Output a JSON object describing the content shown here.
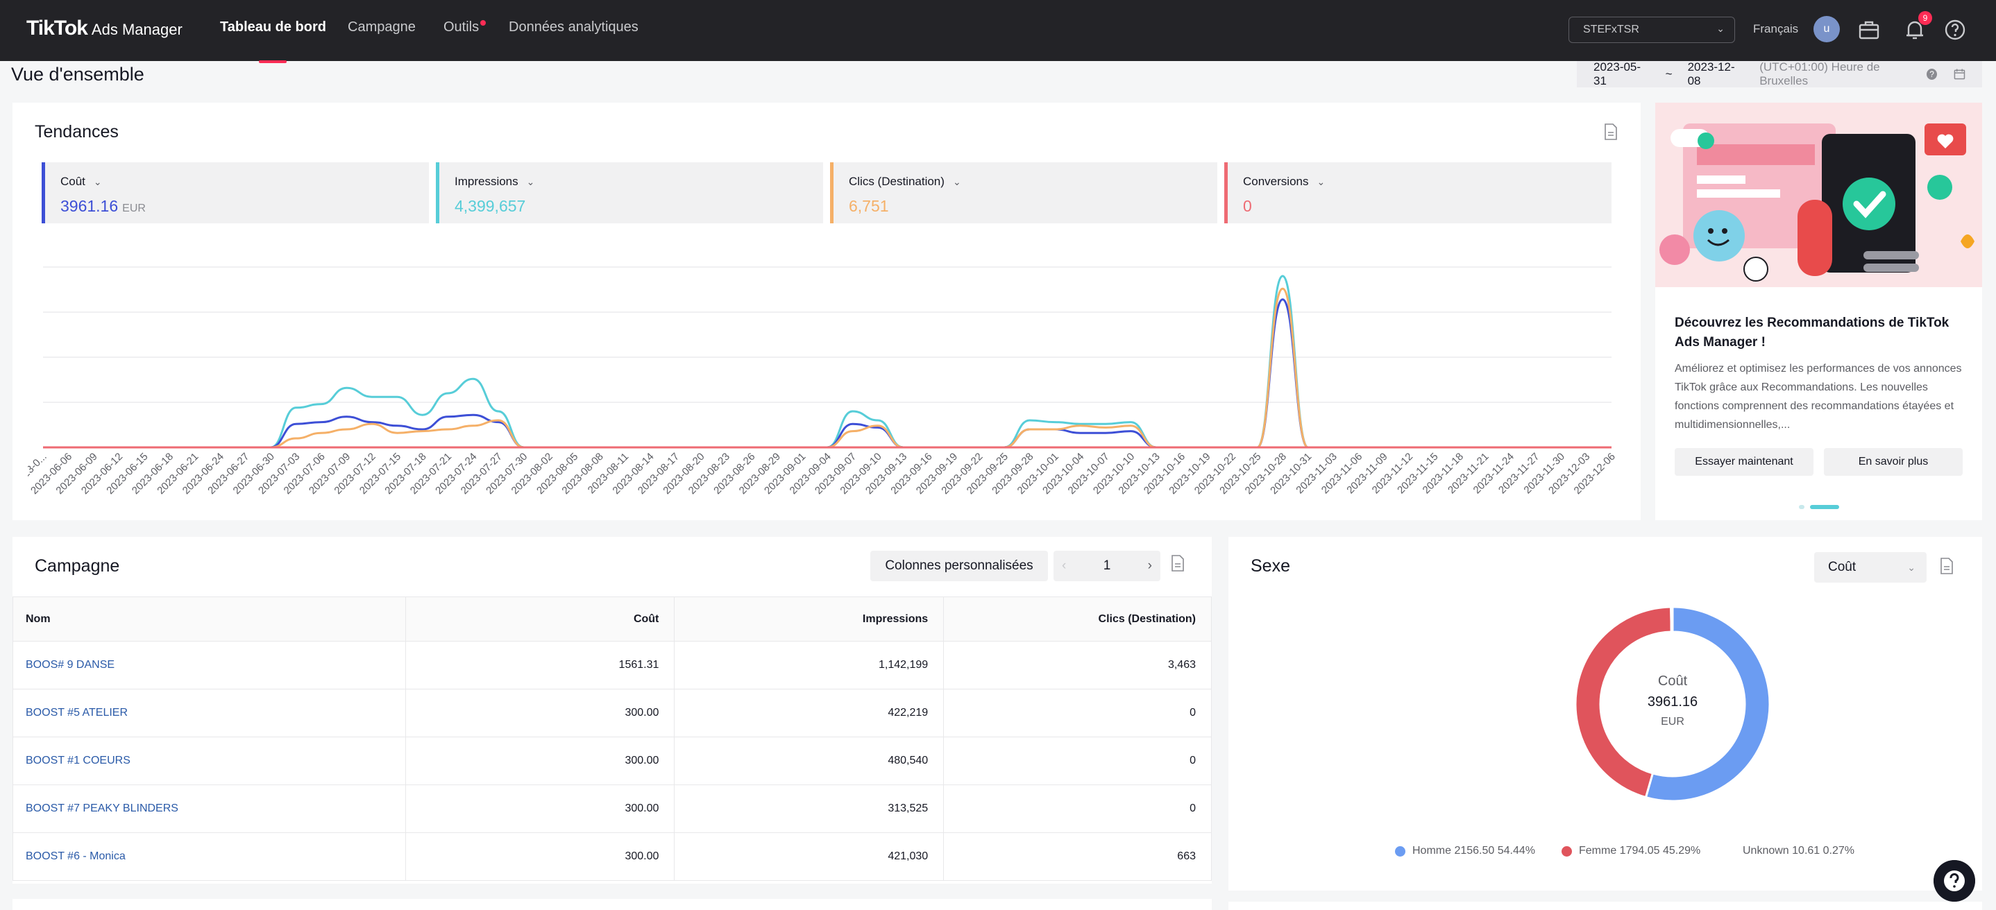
{
  "nav": {
    "brand": "TikTok",
    "product": "Ads Manager",
    "tabs": [
      {
        "label": "Tableau de bord",
        "active": true
      },
      {
        "label": "Campagne"
      },
      {
        "label": "Outils",
        "dot": true
      },
      {
        "label": "Données analytiques"
      }
    ],
    "account": "STEFxTSR",
    "language": "Français",
    "avatar_initial": "u",
    "notification_count": "9",
    "icons": [
      "briefcase-icon",
      "bell-icon",
      "help-icon"
    ]
  },
  "header": {
    "title": "Vue d'ensemble",
    "date_start": "2023-05-31",
    "date_sep": "~",
    "date_end": "2023-12-08",
    "timezone": "(UTC+01:00) Heure de Bruxelles"
  },
  "trends": {
    "title": "Tendances",
    "metrics": [
      {
        "label": "Coût",
        "value": "3961.16",
        "unit": "EUR",
        "color": "#3d4fd6"
      },
      {
        "label": "Impressions",
        "value": "4,399,657",
        "color": "#57cdd8"
      },
      {
        "label": "Clics (Destination)",
        "value": "6,751",
        "color": "#f5b068"
      },
      {
        "label": "Conversions",
        "value": "0",
        "color": "#ee6b73"
      }
    ]
  },
  "chart_data": {
    "type": "line",
    "x": [
      "2023-0...",
      "2023-06-06",
      "2023-06-09",
      "2023-06-12",
      "2023-06-15",
      "2023-06-18",
      "2023-06-21",
      "2023-06-24",
      "2023-06-27",
      "2023-06-30",
      "2023-07-03",
      "2023-07-06",
      "2023-07-09",
      "2023-07-12",
      "2023-07-15",
      "2023-07-18",
      "2023-07-21",
      "2023-07-24",
      "2023-07-27",
      "2023-07-30",
      "2023-08-02",
      "2023-08-05",
      "2023-08-08",
      "2023-08-11",
      "2023-08-14",
      "2023-08-17",
      "2023-08-20",
      "2023-08-23",
      "2023-08-26",
      "2023-08-29",
      "2023-09-01",
      "2023-09-04",
      "2023-09-07",
      "2023-09-10",
      "2023-09-13",
      "2023-09-16",
      "2023-09-19",
      "2023-09-22",
      "2023-09-25",
      "2023-09-28",
      "2023-10-01",
      "2023-10-04",
      "2023-10-07",
      "2023-10-10",
      "2023-10-13",
      "2023-10-16",
      "2023-10-19",
      "2023-10-22",
      "2023-10-25",
      "2023-10-28",
      "2023-10-31",
      "2023-11-03",
      "2023-11-06",
      "2023-11-09",
      "2023-11-12",
      "2023-11-15",
      "2023-11-18",
      "2023-11-21",
      "2023-11-24",
      "2023-11-27",
      "2023-11-30",
      "2023-12-03",
      "2023-12-06"
    ],
    "ylim": [
      0,
      100
    ],
    "grid": true,
    "series": [
      {
        "name": "Impressions",
        "color": "#57cdd8",
        "values": [
          0,
          0,
          0,
          0,
          0,
          0,
          0,
          0,
          0,
          0,
          22,
          24,
          33,
          28,
          28,
          18,
          30,
          38,
          20,
          0,
          0,
          0,
          0,
          0,
          0,
          0,
          0,
          0,
          0,
          0,
          0,
          0,
          20,
          15,
          0,
          0,
          0,
          0,
          0,
          15,
          14,
          13,
          13,
          14,
          0,
          0,
          0,
          0,
          0,
          95,
          0,
          0,
          0,
          0,
          0,
          0,
          0,
          0,
          0,
          0,
          0,
          0,
          0
        ]
      },
      {
        "name": "Coût",
        "color": "#3d4fd6",
        "values": [
          0,
          0,
          0,
          0,
          0,
          0,
          0,
          0,
          0,
          0,
          13,
          14,
          17,
          14,
          12,
          10,
          17,
          18,
          14,
          0,
          0,
          0,
          0,
          0,
          0,
          0,
          0,
          0,
          0,
          0,
          0,
          0,
          13,
          11,
          0,
          0,
          0,
          0,
          0,
          10,
          10,
          8,
          8,
          9,
          0,
          0,
          0,
          0,
          0,
          82,
          0,
          0,
          0,
          0,
          0,
          0,
          0,
          0,
          0,
          0,
          0,
          0,
          0
        ]
      },
      {
        "name": "Clics (Destination)",
        "color": "#f5b068",
        "values": [
          0,
          0,
          0,
          0,
          0,
          0,
          0,
          0,
          0,
          0,
          5,
          8,
          10,
          13,
          8,
          9,
          10,
          12,
          15,
          0,
          0,
          0,
          0,
          0,
          0,
          0,
          0,
          0,
          0,
          0,
          0,
          0,
          9,
          12,
          0,
          0,
          0,
          0,
          0,
          10,
          10,
          12,
          11,
          12,
          0,
          0,
          0,
          0,
          0,
          88,
          0,
          0,
          0,
          0,
          0,
          0,
          0,
          0,
          0,
          0,
          0,
          0,
          0
        ]
      },
      {
        "name": "Conversions",
        "color": "#ee6b73",
        "values": [
          0,
          0,
          0,
          0,
          0,
          0,
          0,
          0,
          0,
          0,
          0,
          0,
          0,
          0,
          0,
          0,
          0,
          0,
          0,
          0,
          0,
          0,
          0,
          0,
          0,
          0,
          0,
          0,
          0,
          0,
          0,
          0,
          0,
          0,
          0,
          0,
          0,
          0,
          0,
          0,
          0,
          0,
          0,
          0,
          0,
          0,
          0,
          0,
          0,
          0,
          0,
          0,
          0,
          0,
          0,
          0,
          0,
          0,
          0,
          0,
          0,
          0,
          0
        ]
      }
    ]
  },
  "promo": {
    "title": "Découvrez les Recommandations de TikTok Ads Manager !",
    "text": "Améliorez et optimisez les performances de vos annonces TikTok grâce aux Recommandations. Les nouvelles fonctions comprennent des recommandations étayées et multidimensionnelles,...",
    "primary_btn": "Essayer maintenant",
    "secondary_btn": "En savoir plus"
  },
  "campaign": {
    "title": "Campagne",
    "columns_btn": "Colonnes personnalisées",
    "page": "1",
    "headers": [
      "Nom",
      "Coût",
      "Impressions",
      "Clics (Destination)"
    ],
    "rows": [
      [
        "BOOS# 9 DANSE",
        "1561.31",
        "1,142,199",
        "3,463"
      ],
      [
        "BOOST #5 ATELIER",
        "300.00",
        "422,219",
        "0"
      ],
      [
        "BOOST #1 COEURS",
        "300.00",
        "480,540",
        "0"
      ],
      [
        "BOOST #7 PEAKY BLINDERS",
        "300.00",
        "313,525",
        "0"
      ],
      [
        "BOOST #6 - Monica",
        "300.00",
        "421,030",
        "663"
      ]
    ]
  },
  "sexe": {
    "title": "Sexe",
    "metric": "Coût",
    "center_label": "Coût",
    "center_value": "3961.16",
    "center_unit": "EUR",
    "legend": [
      {
        "label": "Homme 2156.50 54.44%",
        "color": "#6b9cf2",
        "value": 2156.5
      },
      {
        "label": "Femme 1794.05 45.29%",
        "color": "#e0545c",
        "value": 1794.05
      },
      {
        "label": "Unknown 10.61 0.27%",
        "color": "#ffffff",
        "value": 10.61
      }
    ]
  }
}
